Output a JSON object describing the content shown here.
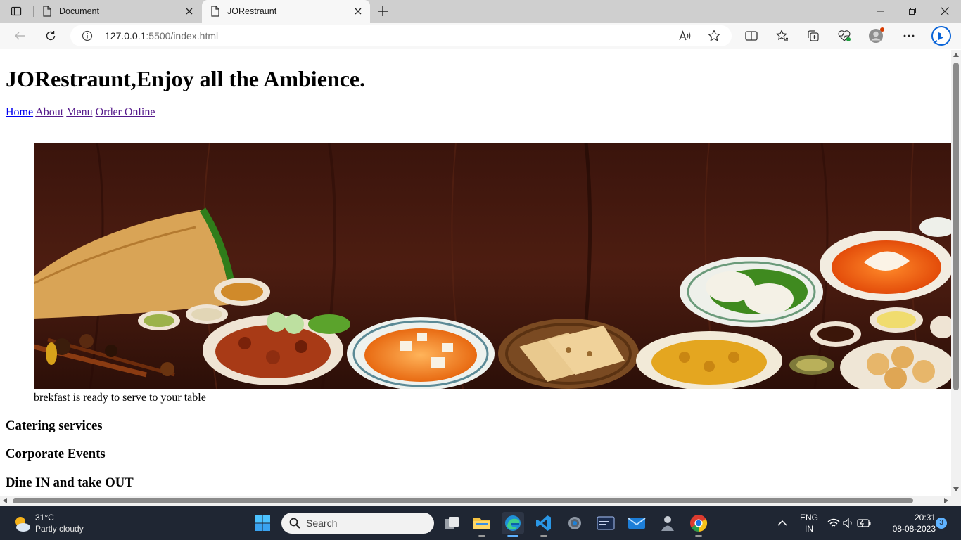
{
  "browser": {
    "tabs": [
      {
        "title": "Document"
      },
      {
        "title": "JORestraunt"
      }
    ],
    "address": {
      "host": "127.0.0.1",
      "rest": ":5500/index.html"
    }
  },
  "page": {
    "heading": "JORestraunt,Enjoy all the Ambience.",
    "nav": [
      "Home",
      "About",
      "Menu",
      "Order Online"
    ],
    "caption": "brekfast is ready to serve to your table",
    "services": [
      "Catering services",
      "Corporate Events",
      "Dine IN and take OUT"
    ]
  },
  "taskbar": {
    "weather": {
      "temp": "31°C",
      "condition": "Partly cloudy"
    },
    "search_label": "Search",
    "lang": {
      "line1": "ENG",
      "line2": "IN"
    },
    "clock": {
      "time": "20:31",
      "date": "08-08-2023"
    },
    "notification_count": "3"
  },
  "colors": {
    "link": "#0000ee",
    "visited_link": "#551a8b",
    "taskbar_bg": "#1f2633",
    "accent": "#0a64d8"
  }
}
